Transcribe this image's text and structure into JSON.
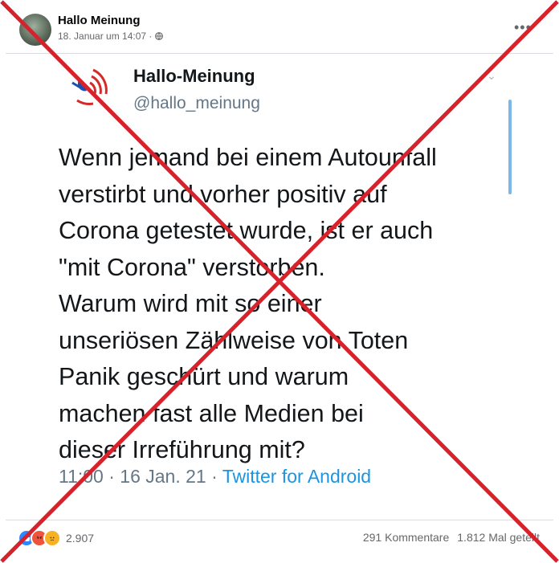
{
  "post": {
    "author": "Hallo Meinung",
    "timestamp": "18. Januar um 14:07 ·",
    "more_icon": "•••"
  },
  "tweet": {
    "name": "Hallo-Meinung",
    "handle": "@hallo_meinung",
    "text": "Wenn jemand bei einem Autounfall\nverstirbt und vorher positiv auf\nCorona getestet wurde, ist er auch\n\"mit Corona\" verstorben.\nWarum wird mit so einer\nunseriösen Zählweise von Toten\nPanik geschürt und warum\nmachen fast alle Medien bei\ndieser Irreführung mit?",
    "time": "11:00 · 16 Jan. 21 · ",
    "source": "Twitter for Android"
  },
  "footer": {
    "reaction_count": "2.907",
    "comments": "291 Kommentare",
    "shares": "1.812 Mal geteilt"
  },
  "colors": {
    "cross": "#d8222b",
    "twitter_blue": "#1b95e0"
  }
}
